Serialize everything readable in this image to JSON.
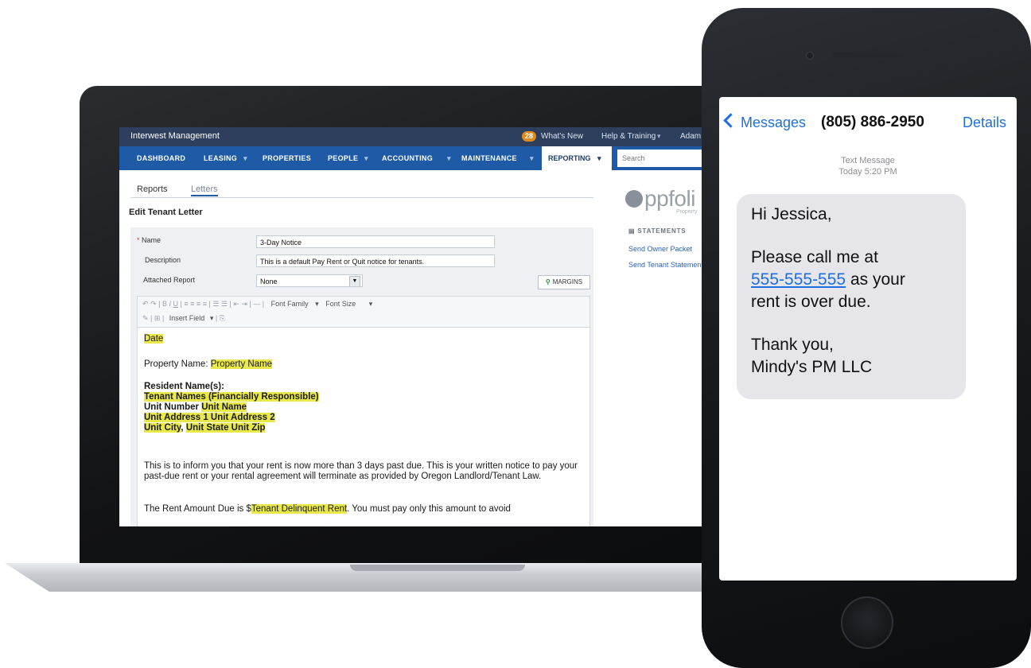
{
  "app": {
    "title": "Interwest Management",
    "whats_new_count": "28",
    "whats_new_label": "What's New",
    "help_label": "Help & Training",
    "user_label": "Adam"
  },
  "nav": {
    "items": [
      "DASHBOARD",
      "LEASING",
      "PROPERTIES",
      "PEOPLE",
      "ACCOUNTING",
      "MAINTENANCE"
    ],
    "active": "REPORTING",
    "search_placeholder": "Search"
  },
  "subtabs": [
    "Reports",
    "Letters"
  ],
  "section_title": "Edit Tenant Letter",
  "form": {
    "name_label": "Name",
    "name_value": "3-Day Notice",
    "description_label": "Description",
    "description_value": "This is a default Pay Rent or Quit notice for tenants.",
    "report_label": "Attached Report",
    "report_value": "None",
    "margins_label": "MARGINS"
  },
  "toolbar": {
    "font_family": "Font Family",
    "font_size": "Font Size",
    "insert_field": "Insert Field"
  },
  "letter": {
    "date": "Date",
    "property_label": "Property Name: ",
    "property_field": "Property Name",
    "residents_heading": "Resident Name(s):",
    "tenant_names": "Tenant Names (Financially Responsible)",
    "unit_number_label": "Unit Number ",
    "unit_name": "Unit Name",
    "unit_address": "Unit Address 1 Unit Address 2",
    "unit_city": "Unit City",
    "unit_state_zip": "Unit State Unit Zip",
    "body_1": "This is to inform you that your rent is now more than 3 days past due. This is your written notice to pay your past-due rent or your rental agreement will terminate as provided by Oregon Landlord/Tenant Law.",
    "body_2_prefix": "The Rent Amount Due is $",
    "delinquent_field": "Tenant Delinquent Rent",
    "body_2_suffix": ". You must pay only this amount to avoid"
  },
  "sidebar": {
    "logo": "ppfoli",
    "logo_sub": "Property",
    "heading": "STATEMENTS",
    "links": [
      "Send Owner Packet",
      "Send Tenant Statement"
    ]
  },
  "phone": {
    "back_label": "Messages",
    "contact": "(805) 886-2950",
    "details_label": "Details",
    "meta_type": "Text Message",
    "meta_time": "Today 5:20 PM",
    "message": {
      "greeting": "Hi Jessica,",
      "line_1": "Please call me at",
      "phone_link": "555-555-555",
      "line_2_suffix": " as your",
      "line_3": "rent is over due.",
      "sign_1": "Thank you,",
      "sign_2": "Mindy's PM LLC"
    }
  },
  "colors": {
    "nav_blue": "#1f5aa6",
    "topbar_navy": "#2d3f5c",
    "field_highlight": "#e9e84a",
    "ios_blue": "#1e6fe0",
    "bubble_gray": "#e5e5ea"
  }
}
